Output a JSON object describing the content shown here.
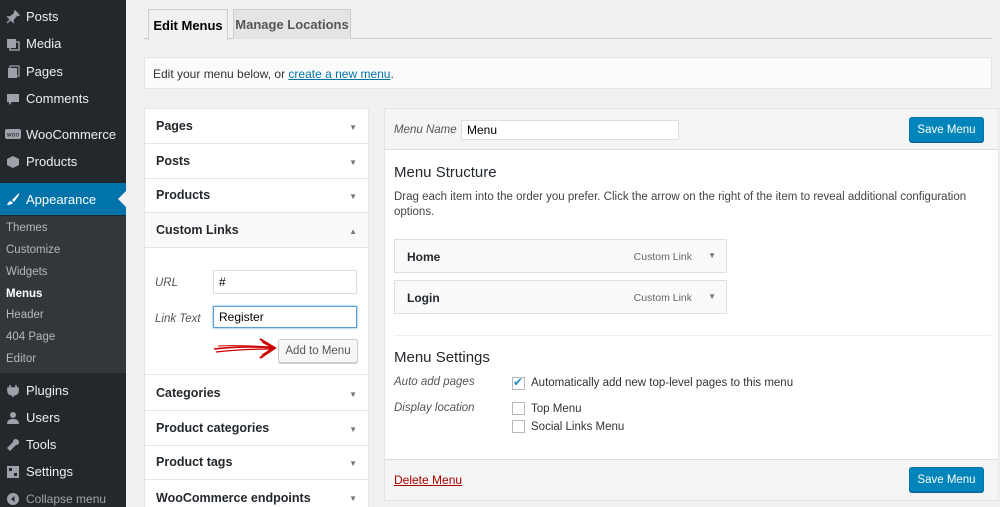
{
  "sidebar": {
    "items": [
      {
        "label": "Posts",
        "icon": "pin-icon"
      },
      {
        "label": "Media",
        "icon": "media-icon"
      },
      {
        "label": "Pages",
        "icon": "pages-icon"
      },
      {
        "label": "Comments",
        "icon": "comment-icon"
      },
      {
        "label": "WooCommerce",
        "icon": "woo-icon"
      },
      {
        "label": "Products",
        "icon": "box-icon"
      },
      {
        "label": "Appearance",
        "icon": "brush-icon"
      }
    ],
    "submenu": [
      "Themes",
      "Customize",
      "Widgets",
      "Menus",
      "Header",
      "404 Page",
      "Editor"
    ],
    "lower_items": [
      {
        "label": "Plugins",
        "icon": "plugin-icon"
      },
      {
        "label": "Users",
        "icon": "user-icon"
      },
      {
        "label": "Tools",
        "icon": "wrench-icon"
      },
      {
        "label": "Settings",
        "icon": "settings-icon"
      }
    ],
    "collapse_label": "Collapse menu"
  },
  "tabs": {
    "edit": "Edit Menus",
    "manage": "Manage Locations"
  },
  "notice": {
    "prefix": "Edit your menu below, or ",
    "link": "create a new menu",
    "suffix": "."
  },
  "accordion": {
    "sections": [
      "Pages",
      "Posts",
      "Products",
      "Custom Links",
      "Categories",
      "Product categories",
      "Product tags",
      "WooCommerce endpoints"
    ],
    "custom_links": {
      "url_label": "URL",
      "url_value": "#",
      "link_text_label": "Link Text",
      "link_text_value": "Register",
      "add_button": "Add to Menu"
    }
  },
  "editor": {
    "menu_name_label": "Menu Name",
    "menu_name_value": "Menu",
    "save_label": "Save Menu",
    "structure_title": "Menu Structure",
    "structure_desc": "Drag each item into the order you prefer. Click the arrow on the right of the item to reveal additional configuration options.",
    "items": [
      {
        "title": "Home",
        "type": "Custom Link"
      },
      {
        "title": "Login",
        "type": "Custom Link"
      }
    ],
    "settings_title": "Menu Settings",
    "auto_add_label": "Auto add pages",
    "auto_add_text": "Automatically add new top-level pages to this menu",
    "display_location_label": "Display location",
    "locations": [
      "Top Menu",
      "Social Links Menu"
    ],
    "delete_label": "Delete Menu"
  },
  "colors": {
    "sidebar_bg": "#23282d",
    "active": "#0073aa",
    "primary_button": "#0085ba",
    "delete": "#aa0000",
    "annotation_arrow": "#cc0000"
  }
}
